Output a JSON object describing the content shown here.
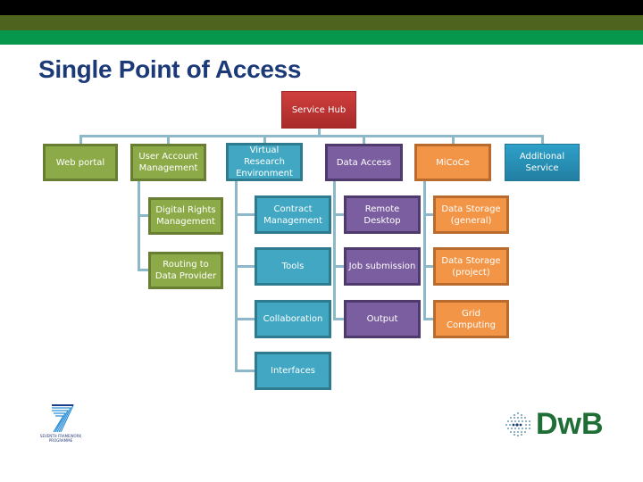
{
  "header": {
    "title": "Single Point of Access"
  },
  "diagram": {
    "root": {
      "label": "Service Hub",
      "color": "#C0363A"
    },
    "columns": [
      {
        "label": "Web portal",
        "color": "#8DAA48",
        "children": []
      },
      {
        "label": "User Account Management",
        "color": "#8DAA48",
        "children": [
          "Digital Rights Management",
          "Routing to Data Provider"
        ]
      },
      {
        "label": "Virtual Research Environment",
        "color": "#41A7C3",
        "children": [
          "Contract Management",
          "Tools",
          "Collaboration",
          "Interfaces"
        ]
      },
      {
        "label": "Data Access",
        "color": "#7A5EA0",
        "children": [
          "Remote Desktop",
          "Job submission",
          "Output"
        ]
      },
      {
        "label": "MiCoCe",
        "color": "#F39547",
        "children": [
          "Data Storage (general)",
          "Data Storage (project)",
          "Grid Computing"
        ]
      },
      {
        "label": "Additional Service",
        "color": "#2A95BE",
        "children": []
      }
    ]
  },
  "logos": {
    "left": {
      "icon": "fp7-logo",
      "text_line1": "SEVENTH FRAMEWORK",
      "text_line2": "PROGRAMME"
    },
    "right": {
      "icon": "dwb-logo",
      "text": "DwB"
    }
  }
}
